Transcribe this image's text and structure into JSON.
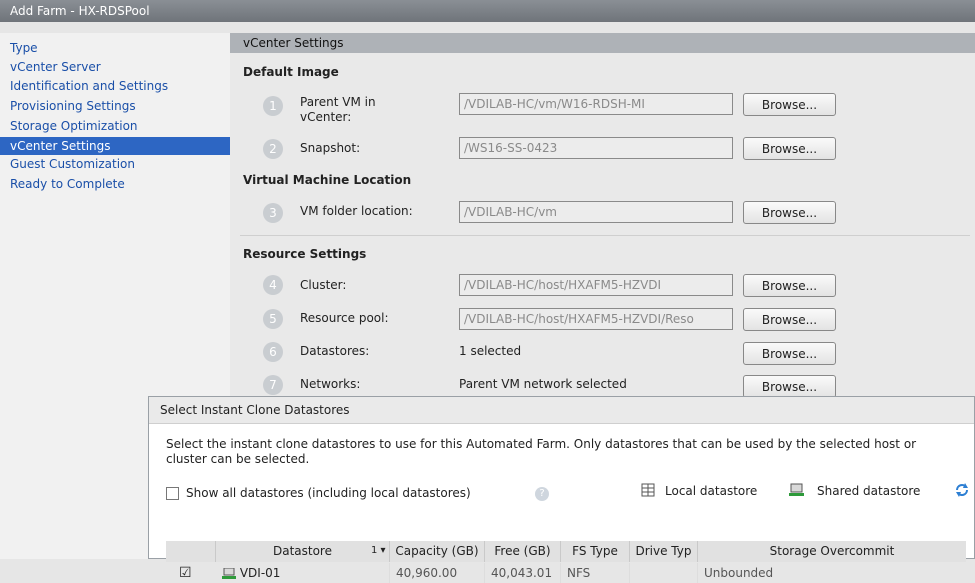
{
  "window": {
    "title": "Add Farm - HX-RDSPool"
  },
  "nav": {
    "items": [
      {
        "label": "Type"
      },
      {
        "label": "vCenter Server"
      },
      {
        "label": "Identification and Settings"
      },
      {
        "label": "Provisioning Settings"
      },
      {
        "label": "Storage Optimization"
      },
      {
        "label": "vCenter Settings",
        "active": true
      },
      {
        "label": "Guest Customization"
      },
      {
        "label": "Ready to Complete"
      }
    ]
  },
  "main": {
    "header": "vCenter Settings",
    "default_image": {
      "title": "Default Image",
      "parent_vm": {
        "step": "1",
        "label": "Parent VM in vCenter:",
        "value": "/VDILAB-HC/vm/W16-RDSH-MI"
      },
      "snapshot": {
        "step": "2",
        "label": "Snapshot:",
        "value": "/WS16-SS-0423"
      }
    },
    "vm_location": {
      "title": "Virtual Machine Location",
      "folder": {
        "step": "3",
        "label": "VM folder location:",
        "value": "/VDILAB-HC/vm"
      }
    },
    "resource": {
      "title": "Resource Settings",
      "cluster": {
        "step": "4",
        "label": "Cluster:",
        "value": "/VDILAB-HC/host/HXAFM5-HZVDI"
      },
      "pool": {
        "step": "5",
        "label": "Resource pool:",
        "value": "/VDILAB-HC/host/HXAFM5-HZVDI/Reso"
      },
      "datastores": {
        "step": "6",
        "label": "Datastores:",
        "value": "1 selected"
      },
      "networks": {
        "step": "7",
        "label": "Networks:",
        "value": "Parent VM network selected"
      }
    },
    "browse_label": "Browse..."
  },
  "dialog": {
    "title": "Select Instant Clone Datastores",
    "description": "Select the instant clone datastores to use for this Automated Farm. Only datastores that can be used by the selected host or cluster can be selected.",
    "show_all_label": "Show all datastores (including local datastores)",
    "legend_local": "Local datastore",
    "legend_shared": "Shared datastore",
    "table": {
      "headers": [
        "Datastore",
        "Capacity (GB)",
        "Free (GB)",
        "FS Type",
        "Drive Typ",
        "Storage Overcommit"
      ],
      "sort_indicator": "1 ▾",
      "rows": [
        {
          "checked": true,
          "datastore": "VDI-01",
          "capacity": "40,960.00",
          "free": "40,043.01",
          "fs_type": "NFS",
          "drive_type": "",
          "overcommit": "Unbounded"
        }
      ]
    }
  },
  "colors": {
    "accent": "#2d66c3",
    "link": "#1a4fa8"
  },
  "icons": [
    "help-icon",
    "local-datastore-icon",
    "shared-datastore-icon",
    "refresh-icon",
    "checkbox-checked-icon"
  ]
}
